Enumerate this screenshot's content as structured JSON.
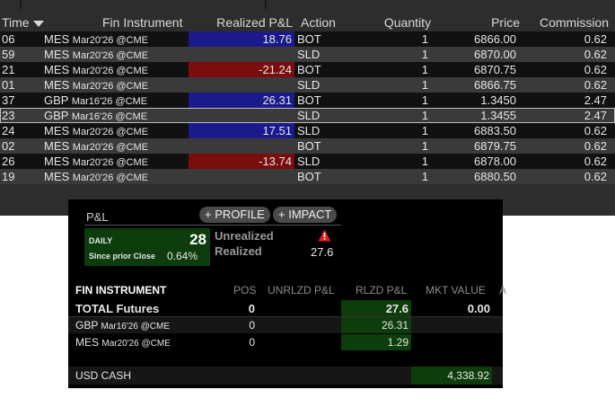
{
  "trades": {
    "columns": {
      "time": "Time",
      "instrument": "Fin Instrument",
      "realized_pnl": "Realized P&L",
      "action": "Action",
      "quantity": "Quantity",
      "price": "Price",
      "commission": "Commission"
    },
    "rows": [
      {
        "time": "06",
        "sym": "MES",
        "exp": "Mar20'26 @CME",
        "pnl": "18.76",
        "pnl_sign": "pos",
        "action": "BOT",
        "qty": "1",
        "price": "6866.00",
        "comm": "0.62"
      },
      {
        "time": "59",
        "sym": "MES",
        "exp": "Mar20'26 @CME",
        "pnl": "",
        "pnl_sign": "",
        "action": "SLD",
        "qty": "1",
        "price": "6870.00",
        "comm": "0.62"
      },
      {
        "time": "21",
        "sym": "MES",
        "exp": "Mar20'26 @CME",
        "pnl": "-21.24",
        "pnl_sign": "neg",
        "action": "BOT",
        "qty": "1",
        "price": "6870.75",
        "comm": "0.62"
      },
      {
        "time": "01",
        "sym": "MES",
        "exp": "Mar20'26 @CME",
        "pnl": "",
        "pnl_sign": "",
        "action": "SLD",
        "qty": "1",
        "price": "6866.75",
        "comm": "0.62"
      },
      {
        "time": "37",
        "sym": "GBP",
        "exp": "Mar16'26 @CME",
        "pnl": "26.31",
        "pnl_sign": "pos",
        "action": "BOT",
        "qty": "1",
        "price": "1.3450",
        "comm": "2.47"
      },
      {
        "time": "23",
        "sym": "GBP",
        "exp": "Mar16'26 @CME",
        "pnl": "",
        "pnl_sign": "",
        "action": "SLD",
        "qty": "1",
        "price": "1.3455",
        "comm": "2.47"
      },
      {
        "time": "24",
        "sym": "MES",
        "exp": "Mar20'26 @CME",
        "pnl": "17.51",
        "pnl_sign": "pos",
        "action": "SLD",
        "qty": "1",
        "price": "6883.50",
        "comm": "0.62"
      },
      {
        "time": "02",
        "sym": "MES",
        "exp": "Mar20'26 @CME",
        "pnl": "",
        "pnl_sign": "",
        "action": "BOT",
        "qty": "1",
        "price": "6879.75",
        "comm": "0.62"
      },
      {
        "time": "26",
        "sym": "MES",
        "exp": "Mar20'26 @CME",
        "pnl": "-13.74",
        "pnl_sign": "neg",
        "action": "SLD",
        "qty": "1",
        "price": "6878.00",
        "comm": "0.62"
      },
      {
        "time": "19",
        "sym": "MES",
        "exp": "Mar20'26 @CME",
        "pnl": "",
        "pnl_sign": "",
        "action": "BOT",
        "qty": "1",
        "price": "6880.50",
        "comm": "0.62"
      }
    ]
  },
  "pnl_panel": {
    "title": "P&L",
    "profile_button": "PROFILE",
    "impact_button": "IMPACT",
    "daily_label": "DAILY",
    "daily_value": "28",
    "since_label": "Since prior Close",
    "since_pct": "0.64%",
    "unrealized_label": "Unrealized",
    "realized_label": "Realized",
    "realized_value": "27.6",
    "headers": {
      "instrument": "FIN INSTRUMENT",
      "pos": "POS",
      "unrlzd": "UNRLZD P&L",
      "rlzd": "RLZD P&L",
      "mkt_value": "MKT VALUE",
      "extra": "A"
    },
    "total": {
      "name": "TOTAL Futures",
      "pos": "0",
      "rlzd": "27.6",
      "mkt_value": "0.00"
    },
    "positions": [
      {
        "sym": "GBP",
        "exp": "Mar16'26 @CME",
        "pos": "0",
        "rlzd": "26.31"
      },
      {
        "sym": "MES",
        "exp": "Mar20'26 @CME",
        "pos": "0",
        "rlzd": "1.29"
      }
    ],
    "cash": {
      "name": "USD CASH",
      "amount": "4,338.92"
    }
  },
  "colors": {
    "positive_pnl": "#1a1a8c",
    "negative_pnl": "#7a0d0d",
    "green_cell": "#0d3d0d",
    "warning": "#e02020"
  }
}
